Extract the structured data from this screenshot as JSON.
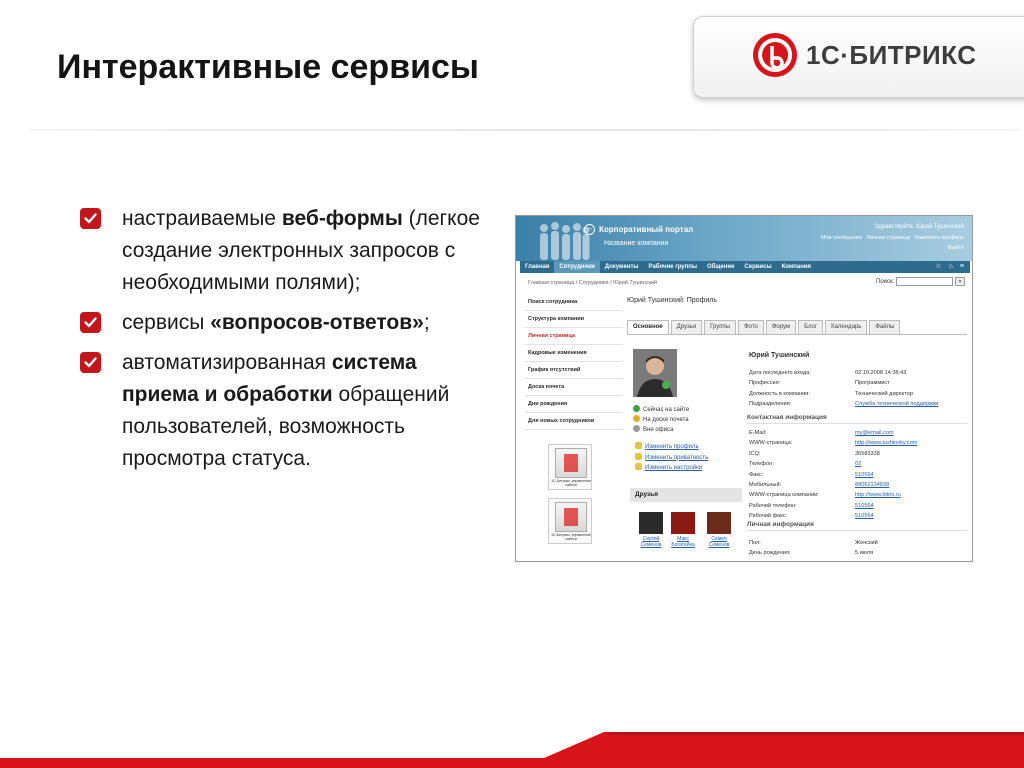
{
  "slide": {
    "title": "Интерактивные сервисы",
    "logo_text": "1С·БИТРИКС",
    "accent": "#d7141a"
  },
  "bullets": [
    {
      "icon": "checkbox-checked-icon",
      "parts": [
        {
          "text": "настраиваемые ",
          "bold": false
        },
        {
          "text": "веб-формы",
          "bold": true
        },
        {
          "text": " (легкое создание электронных запросов с необходимыми полями);",
          "bold": false
        }
      ]
    },
    {
      "icon": "checkbox-checked-icon",
      "parts": [
        {
          "text": " сервисы ",
          "bold": false
        },
        {
          "text": "«вопросов-ответов»",
          "bold": true
        },
        {
          "text": ";",
          "bold": false
        }
      ]
    },
    {
      "icon": "checkbox-checked-icon",
      "parts": [
        {
          "text": " автоматизированная ",
          "bold": false
        },
        {
          "text": "система приема и обработки",
          "bold": true
        },
        {
          "text": " обращений пользователей, возможность просмотра статуса.",
          "bold": false
        }
      ]
    }
  ],
  "portal": {
    "header": {
      "title": "Корпоративный портал",
      "company": "Название компании",
      "greeting": "Здравствуйте, Юрий Тушинский",
      "links": [
        "Мои сообщения",
        "Личная страница",
        "Изменить профиль"
      ],
      "exit": "Выйти"
    },
    "nav": [
      {
        "label": "Главная",
        "active": false
      },
      {
        "label": "Сотрудники",
        "active": true
      },
      {
        "label": "Документы",
        "active": false
      },
      {
        "label": "Рабочие группы",
        "active": false
      },
      {
        "label": "Общение",
        "active": false
      },
      {
        "label": "Сервисы",
        "active": false
      },
      {
        "label": "Компания",
        "active": false
      }
    ],
    "nav_icons": [
      "☆",
      "⌂",
      "≡"
    ],
    "breadcrumb": "Главная страница / Сотрудники / Юрий Тушинский",
    "search": {
      "label": "Поиск:",
      "value": "",
      "button": "»"
    },
    "sidebar": [
      {
        "label": "Поиск сотрудника",
        "active": false
      },
      {
        "label": "Структура компании",
        "active": false
      },
      {
        "label": "Личная страница",
        "active": true
      },
      {
        "label": "Кадровые изменения",
        "active": false
      },
      {
        "label": "График отсутствий",
        "active": false
      },
      {
        "label": "Доска почета",
        "active": false
      },
      {
        "label": "Дни рождения",
        "active": false
      },
      {
        "label": "Для новых сотрудников",
        "active": false
      }
    ],
    "promo_caption": "1С-Битрикс: управление сайтом",
    "profile_title": "Юрий Тушинский: Профиль",
    "tabs": [
      {
        "label": "Основное",
        "active": true
      },
      {
        "label": "Друзья",
        "active": false
      },
      {
        "label": "Группы",
        "active": false
      },
      {
        "label": "Фото",
        "active": false
      },
      {
        "label": "Форум",
        "active": false
      },
      {
        "label": "Блог",
        "active": false
      },
      {
        "label": "Календарь",
        "active": false
      },
      {
        "label": "Файлы",
        "active": false
      }
    ],
    "status": [
      {
        "label": "Сейчас на сайте",
        "color": "#3aa53a"
      },
      {
        "label": "На доске почета",
        "color": "#e0b020"
      },
      {
        "label": "Вне офиса",
        "color": "#999999"
      }
    ],
    "actions": [
      "Изменить профиль",
      "Изменить приватность",
      "Изменить настройки"
    ],
    "friends_title": "Друзья",
    "friends": [
      {
        "name": "Сергей Семенов"
      },
      {
        "name": "Макс Богатейка"
      },
      {
        "name": "Семен Семенов"
      }
    ],
    "person_name": "Юрий Тушинский",
    "general": [
      {
        "k": "Дата последнего входа:",
        "v": "02.10.2008 14:38:43",
        "link": false
      },
      {
        "k": "Профессия:",
        "v": "Программист",
        "link": false
      },
      {
        "k": "Должность в компании:",
        "v": "Технический директор",
        "link": false
      },
      {
        "k": "Подразделения:",
        "v": "Служба технической поддержки",
        "link": true
      }
    ],
    "contact_title": "Контактная информация",
    "contact": [
      {
        "k": "E-Mail:",
        "v": "my@email.com",
        "link": true
      },
      {
        "k": "WWW-страница:",
        "v": "http://www.tushinsky.com",
        "link": true
      },
      {
        "k": "ICQ:",
        "v": "36583338",
        "link": false
      },
      {
        "k": "Телефон:",
        "v": "02",
        "link": true
      },
      {
        "k": "Факс:",
        "v": "510564",
        "link": true
      },
      {
        "k": "Мобильный:",
        "v": "89062134838",
        "link": true
      },
      {
        "k": "WWW-страница компании:",
        "v": "http://www.bitrix.ru",
        "link": true
      },
      {
        "k": "Рабочий телефон:",
        "v": "510564",
        "link": true
      },
      {
        "k": "Рабочий факс:",
        "v": "510564",
        "link": true
      }
    ],
    "personal_title": "Личная информация",
    "personal": [
      {
        "k": "Пол:",
        "v": "Женский",
        "link": false
      },
      {
        "k": "День рождения:",
        "v": "5 июля",
        "link": false
      }
    ]
  }
}
